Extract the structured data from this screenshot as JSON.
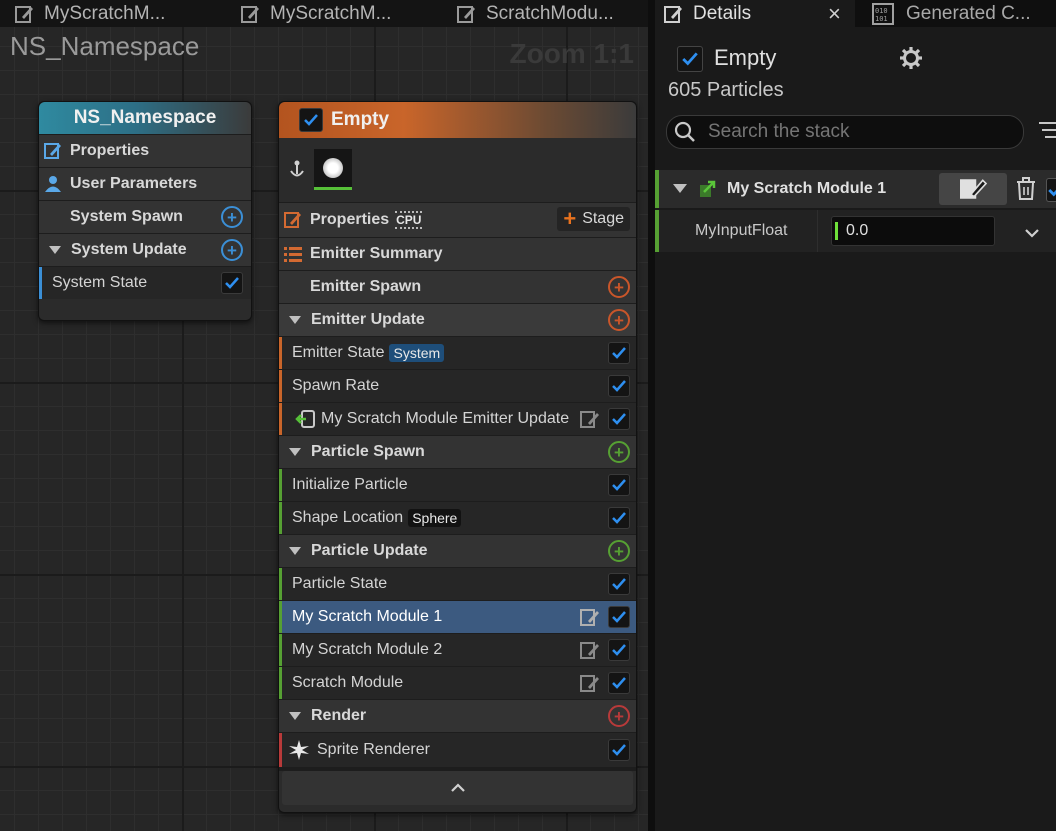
{
  "graph": {
    "tabs": [
      {
        "label": "MyScratchM..."
      },
      {
        "label": "MyScratchM..."
      },
      {
        "label": "ScratchModu..."
      }
    ],
    "title": "NS_Namespace",
    "zoom": "Zoom 1:1"
  },
  "system_node": {
    "title": "NS_Namespace",
    "rows": {
      "properties": "Properties",
      "user_parameters": "User Parameters",
      "system_spawn": "System Spawn",
      "system_update": "System Update",
      "system_state": "System State"
    }
  },
  "emitter_node": {
    "title": "Empty",
    "properties": "Properties",
    "cpu_badge": "CPU",
    "stage_button": "Stage",
    "emitter_summary": "Emitter Summary",
    "emitter_spawn": "Emitter Spawn",
    "emitter_update": "Emitter Update",
    "emitter_state": "Emitter State",
    "emitter_state_tag": "System",
    "spawn_rate": "Spawn Rate",
    "scratch_emitter_update": "My Scratch Module Emitter Update",
    "particle_spawn": "Particle Spawn",
    "initialize_particle": "Initialize Particle",
    "shape_location": "Shape Location",
    "shape_location_tag": "Sphere",
    "particle_update": "Particle Update",
    "particle_state": "Particle State",
    "scratch_1": "My Scratch Module 1",
    "scratch_2": "My Scratch Module 2",
    "scratch_module": "Scratch Module",
    "render": "Render",
    "sprite_renderer": "Sprite Renderer"
  },
  "details": {
    "tabs": [
      {
        "label": "Details"
      },
      {
        "label": "Generated C..."
      }
    ],
    "close_glyph": "×",
    "emitter_name": "Empty",
    "particle_count": "605 Particles",
    "search_placeholder": "Search the stack",
    "module_title": "My Scratch Module 1",
    "input_label": "MyInputFloat",
    "input_value": "0.0"
  },
  "colors": {
    "accent_blue": "#1f7bd6",
    "emitter_orange": "#c9652a",
    "system_teal": "#2f8aa0",
    "particle_green": "#56a033",
    "render_red": "#b83a3a",
    "selected_row": "#3c5a80"
  }
}
